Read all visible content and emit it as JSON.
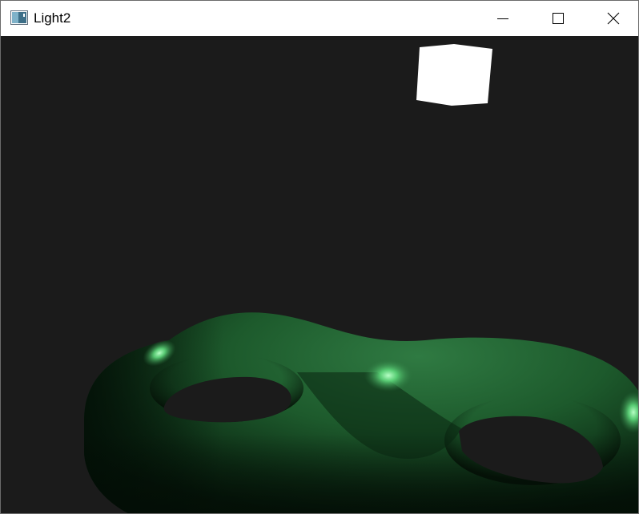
{
  "window": {
    "title": "Light2",
    "icons": {
      "app": "application-window-icon",
      "minimize": "minimize-icon",
      "maximize": "maximize-icon",
      "close": "close-icon"
    }
  },
  "scene": {
    "background_color": "#1b1b1b",
    "objects": [
      {
        "name": "light-source-cube",
        "color": "#ffffff"
      },
      {
        "name": "double-torus-mesh",
        "color": "#2f7a42"
      }
    ]
  }
}
